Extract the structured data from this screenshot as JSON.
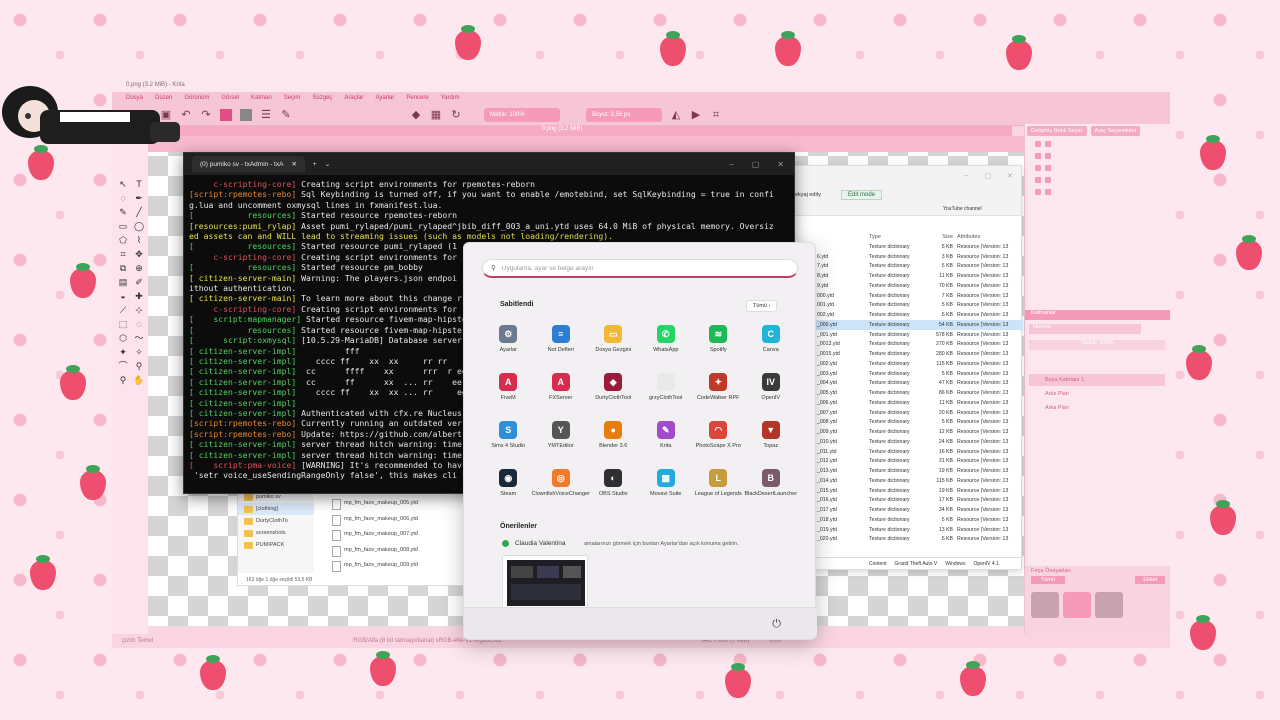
{
  "krita": {
    "title": "0.png (3.2 MiB) - Krita",
    "menu": [
      "Dosya",
      "Düzen",
      "Görünüm",
      "Görsel",
      "Katman",
      "Seçim",
      "Süzgeç",
      "Araçlar",
      "Ayarlar",
      "Pencere",
      "Yardım"
    ],
    "opacity_label": "Matlık: 100%",
    "size_label": "Boyut: 2,56 px",
    "document_tab": "0.png (3,2 MiB)",
    "dock_tabs": [
      "Gelişmiş Renk Seçici",
      "Araç Seçenekleri"
    ],
    "layers_title": "Katmanlar",
    "blend_mode": "Normal",
    "layer_opacity": "Matlık: 100%",
    "layers": [
      "Boya Katmanı 1",
      "Arka Plan",
      "Arka Plan"
    ],
    "brush_title": "Fırça Önayarları",
    "brush_filter": "Tümü",
    "brush_tag": "Etiket",
    "status_left": "çizim Temel",
    "status_mid": "RGB/Alfa (8 bit tamsayı/kanal) sRGB-elle-V2-srgbtrc.icc",
    "status_right": "845 × 800 (7 MiB)",
    "zoom": "0,00°"
  },
  "terminal": {
    "tab_title": "(0) pumiko sv - txAdmin - txA"
  },
  "terminal_lines": [
    [
      "c-red",
      "     c-scripting-core]",
      " Creating script environments for rpemotes-reborn"
    ],
    [
      "c-orange",
      "[script:rpemotes-rebo]",
      " Sql Keybinding is turned off, if you want to enable /emotebind, set SqlKeybinding = true in confi"
    ],
    [
      "",
      "g.lua and uncomment oxmysql lines in fxmanifest.lua.",
      ""
    ],
    [
      "c-green",
      "[           resources]",
      " Started resource rpemotes-reborn"
    ],
    [
      "c-yellow",
      "[resources:pumi_rylap]",
      " Asset pumi_rylaped/pumi_rylaped^jbib_diff_003_a_uni.ytd uses 64.0 MiB of physical memory. Oversiz"
    ],
    [
      "c-yellow",
      "ed assets can and WILL lead to streaming issues (such as models not loading/rendering).",
      ""
    ],
    [
      "c-green",
      "[           resources]",
      " Started resource pumi_rylaped (1"
    ],
    [
      "c-red",
      "     c-scripting-core]",
      " Creating script environments for"
    ],
    [
      "c-green",
      "[           resources]",
      " Started resource pm_bobby"
    ],
    [
      "c-yellow",
      "[ citizen-server-main]",
      " Warning: The players.json endpoi"
    ],
    [
      "",
      "ithout authentication.",
      ""
    ],
    [
      "c-yellow",
      "[ citizen-server-main]",
      " To learn more about this change r"
    ],
    [
      "c-red",
      "     c-scripting-core]",
      " Creating script environments for"
    ],
    [
      "c-green",
      "[    script:mapmanager]",
      " Started resource fivem-map-hipster"
    ],
    [
      "c-green",
      "[           resources]",
      " Started resource fivem-map-hipste"
    ],
    [
      "c-green",
      "[      script:oxmysql]",
      " [10.5.29-MariaDB] Database server"
    ],
    [
      "c-green",
      "[ citizen-server-impl]",
      "          fff"
    ],
    [
      "c-green",
      "[ citizen-server-impl]",
      "    cccc ff    xx  xx     rr rr"
    ],
    [
      "c-green",
      "[ citizen-server-impl]",
      "  cc      ffff    xx      rrr  r ee"
    ],
    [
      "c-green",
      "[ citizen-server-impl]",
      "  cc      ff      xx  ... rr    ee"
    ],
    [
      "c-green",
      "[ citizen-server-impl]",
      "    cccc ff    xx  xx ... rr     ee"
    ],
    [
      "c-green",
      "[ citizen-server-impl]",
      ""
    ],
    [
      "c-green",
      "[ citizen-server-impl]",
      " Authenticated with cfx.re Nucleus"
    ],
    [
      "c-orange",
      "[script:rpemotes-rebo]",
      " Currently running an outdated ver"
    ],
    [
      "c-orange",
      "[script:rpemotes-rebo]",
      " Update: https://github.com/albert"
    ],
    [
      "c-green",
      "[ citizen-server-impl]",
      " server thread hitch warning: time"
    ],
    [
      "c-green",
      "[ citizen-server-impl]",
      " server thread hitch warning: time"
    ],
    [
      "c-red",
      "[    script:pma-voice]",
      " [WARNING] It's recommended to hav"
    ],
    [
      "",
      " 'setr voice_useSendingRangeOnly false', this makes cli",
      ""
    ]
  ],
  "explorer": {
    "sidebar": [
      "pumiko sv",
      "[clothing]",
      "DurtyClothTo",
      "screenshots",
      "PUMIPACK"
    ],
    "files": [
      "mp_fm_faov_makeup_005.ytd",
      "mp_fm_faov_makeup_006.ytd",
      "mp_fm_faov_makeup_007.ytd",
      "mp_fm_faov_makeup_008.ytd",
      "mp_fm_faov_makeup_009.ytd"
    ],
    "status": "163 öğe    1 öğe seçildi  53,5 KB"
  },
  "filewin": {
    "breadcrumb": "ekyaj edity",
    "edit_mode": "Edit mode",
    "youtube": "YouTube channel",
    "columns": [
      "",
      "Type",
      "Size",
      "Attributes"
    ],
    "rows": [
      [
        "",
        "Texture dictionary",
        "5 KB",
        "Resource (Version: 13"
      ],
      [
        "6.ytd",
        "Texture dictionary",
        "3 KB",
        "Resource (Version: 13"
      ],
      [
        "7.ytd",
        "Texture dictionary",
        "5 KB",
        "Resource (Version: 13"
      ],
      [
        "8.ytd",
        "Texture dictionary",
        "11 KB",
        "Resource (Version: 13"
      ],
      [
        "9.ytd",
        "Texture dictionary",
        "70 KB",
        "Resource (Version: 13"
      ],
      [
        "000.ytd",
        "Texture dictionary",
        "7 KB",
        "Resource (Version: 13"
      ],
      [
        "001.ytd",
        "Texture dictionary",
        "5 KB",
        "Resource (Version: 13"
      ],
      [
        "002.ytd",
        "Texture dictionary",
        "5 KB",
        "Resource (Version: 13"
      ],
      [
        "_000.ytd",
        "Texture dictionary",
        "54 KB",
        "Resource (Version: 13"
      ],
      [
        "_001.ytd",
        "Texture dictionary",
        "578 KB",
        "Resource (Version: 13"
      ],
      [
        "_0013.ytd",
        "Texture dictionary",
        "270 KB",
        "Resource (Version: 13"
      ],
      [
        "_0015.ytd",
        "Texture dictionary",
        "280 KB",
        "Resource (Version: 13"
      ],
      [
        "_002.ytd",
        "Texture dictionary",
        "115 KB",
        "Resource (Version: 13"
      ],
      [
        "_003.ytd",
        "Texture dictionary",
        "5 KB",
        "Resource (Version: 13"
      ],
      [
        "_004.ytd",
        "Texture dictionary",
        "47 KB",
        "Resource (Version: 13"
      ],
      [
        "_005.ytd",
        "Texture dictionary",
        "86 KB",
        "Resource (Version: 13"
      ],
      [
        "_006.ytd",
        "Texture dictionary",
        "11 KB",
        "Resource (Version: 13"
      ],
      [
        "_007.ytd",
        "Texture dictionary",
        "20 KB",
        "Resource (Version: 13"
      ],
      [
        "_008.ytd",
        "Texture dictionary",
        "5 KB",
        "Resource (Version: 13"
      ],
      [
        "_009.ytd",
        "Texture dictionary",
        "12 KB",
        "Resource (Version: 13"
      ],
      [
        "_010.ytd",
        "Texture dictionary",
        "24 KB",
        "Resource (Version: 13"
      ],
      [
        "_011.ytd",
        "Texture dictionary",
        "16 KB",
        "Resource (Version: 13"
      ],
      [
        "_012.ytd",
        "Texture dictionary",
        "31 KB",
        "Resource (Version: 13"
      ],
      [
        "_013.ytd",
        "Texture dictionary",
        "19 KB",
        "Resource (Version: 13"
      ],
      [
        "_014.ytd",
        "Texture dictionary",
        "115 KB",
        "Resource (Version: 13"
      ],
      [
        "_015.ytd",
        "Texture dictionary",
        "19 KB",
        "Resource (Version: 13"
      ],
      [
        "_016.ytd",
        "Texture dictionary",
        "17 KB",
        "Resource (Version: 13"
      ],
      [
        "_017.ytd",
        "Texture dictionary",
        "34 KB",
        "Resource (Version: 13"
      ],
      [
        "_018.ytd",
        "Texture dictionary",
        "5 KB",
        "Resource (Version: 13"
      ],
      [
        "_019.ytd",
        "Texture dictionary",
        "13 KB",
        "Resource (Version: 13"
      ],
      [
        "_020.ytd",
        "Texture dictionary",
        "5 KB",
        "Resource (Version: 13"
      ]
    ],
    "bottom": [
      "Content",
      "Grand Theft Auto V",
      "Windows",
      "OpenIV 4.1"
    ]
  },
  "start": {
    "search_placeholder": "Uygulama, ayar ve belge arayın",
    "pinned_title": "Sabitlendi",
    "all_label": "Tümü",
    "apps": [
      {
        "label": "Ayarlar",
        "color": "#6b7a8f",
        "glyph": "⚙"
      },
      {
        "label": "Not Defteri",
        "color": "#2d7dd2",
        "glyph": "≡"
      },
      {
        "label": "Dosya Gezgini",
        "color": "#f2b936",
        "glyph": "▭"
      },
      {
        "label": "WhatsApp",
        "color": "#25d366",
        "glyph": "✆"
      },
      {
        "label": "Spotify",
        "color": "#1db954",
        "glyph": "≋"
      },
      {
        "label": "Canva",
        "color": "#1fb5d8",
        "glyph": "C"
      },
      {
        "label": "FiveM",
        "color": "#d62d4f",
        "glyph": "A"
      },
      {
        "label": "FXServer",
        "color": "#d62d4f",
        "glyph": "A"
      },
      {
        "label": "DurtyClothTool",
        "color": "#9b1c3a",
        "glyph": "◆"
      },
      {
        "label": "grzyClothTool",
        "color": "#e9e9e9",
        "glyph": ""
      },
      {
        "label": "CodeWalker RPF",
        "color": "#c0392b",
        "glyph": "✦"
      },
      {
        "label": "OpenIV",
        "color": "#3a3a3a",
        "glyph": "IV"
      },
      {
        "label": "Sims 4 Studio",
        "color": "#2f8fd8",
        "glyph": "S"
      },
      {
        "label": "YMTEditor",
        "color": "#555555",
        "glyph": "Y"
      },
      {
        "label": "Blender 3.6",
        "color": "#e87d0d",
        "glyph": "●"
      },
      {
        "label": "Krita",
        "color": "#a14cc9",
        "glyph": "✎"
      },
      {
        "label": "PhotoScape X Pro",
        "color": "#d9463b",
        "glyph": "◠"
      },
      {
        "label": "Topaz",
        "color": "#b3352a",
        "glyph": "▼"
      },
      {
        "label": "Steam",
        "color": "#1b2838",
        "glyph": "◉"
      },
      {
        "label": "ClownfishVoiceChanger",
        "color": "#f07b2a",
        "glyph": "◎"
      },
      {
        "label": "OBS Studio",
        "color": "#302e31",
        "glyph": "◐"
      },
      {
        "label": "Movavi Suite",
        "color": "#26a8e0",
        "glyph": "▦"
      },
      {
        "label": "League of Legends",
        "color": "#c89b3c",
        "glyph": "L"
      },
      {
        "label": "BlackDesertLauncher",
        "color": "#7b5a6c",
        "glyph": "B"
      }
    ],
    "recommended_title": "Önerilenler",
    "recommended_user": "Claudia Valentina",
    "recommended_note": "amalarınızı görmek için bunları Ayarlar'dan açık konuma getirin."
  },
  "colors": {
    "accent_pink": "#f59ab9",
    "krita_bg": "#f8d5e1",
    "terminal_bg": "#0c0c0c"
  }
}
